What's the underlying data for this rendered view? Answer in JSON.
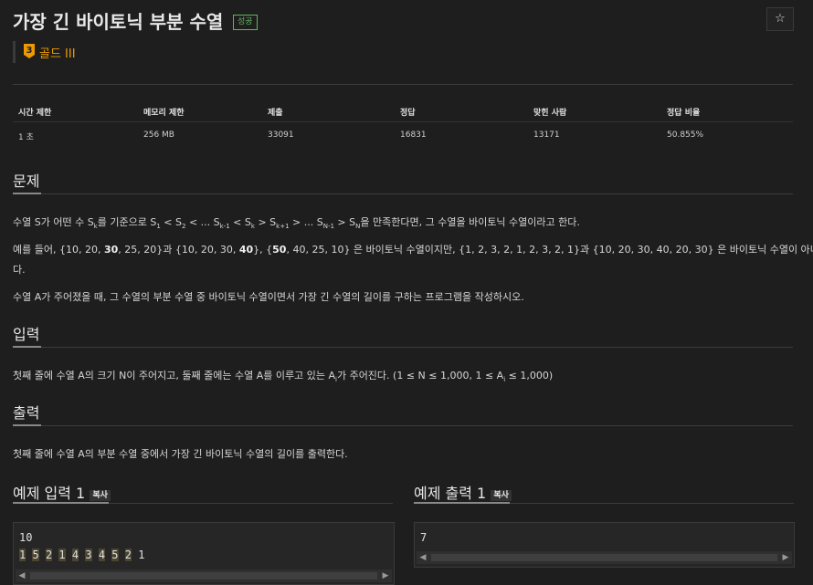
{
  "header": {
    "title": "가장 긴 바이토닉 부분 수열",
    "status_badge": "성공",
    "star_icon": "☆",
    "tier_number": "3",
    "tier_label": "골드 III"
  },
  "stats": {
    "headers": [
      "시간 제한",
      "메모리 제한",
      "제출",
      "정답",
      "맞힌 사람",
      "정답 비율"
    ],
    "values": [
      "1 초",
      "256 MB",
      "33091",
      "16831",
      "13171",
      "50.855%"
    ]
  },
  "problem": {
    "heading": "문제",
    "line1_pre": "수열 S가 어떤 수 S",
    "line1_k": "k",
    "line1_mid": "를 기준으로 S",
    "line1_1": "1",
    "line1_lt1": " < S",
    "line1_2": "2",
    "line1_lt2": " < ... S",
    "line1_km1": "k-1",
    "line1_lt3": " < S",
    "line1_k2": "k",
    "line1_gt1": " > S",
    "line1_kp1": "k+1",
    "line1_gt2": " > ... S",
    "line1_nm1": "N-1",
    "line1_gt3": " > S",
    "line1_n": "N",
    "line1_post": "을 만족한다면, 그 수열을 바이토닉 수열이라고 한다.",
    "line2_a": "예를 들어, {10, 20, ",
    "line2_b": "30",
    "line2_c": ", 25, 20}과 {10, 20, 30, ",
    "line2_d": "40",
    "line2_e": "}, {",
    "line2_f": "50",
    "line2_g": ", 40, 25, 10} 은 바이토닉 수열이지만,  {1, 2, 3, 2, 1, 2, 3, 2, 1}과 {10, 20, 30, 40, 20, 30} 은 바이토닉 수열이 아니",
    "line2_h": "다.",
    "line3": "수열 A가 주어졌을 때, 그 수열의 부분 수열 중 바이토닉 수열이면서 가장 긴 수열의 길이를 구하는 프로그램을 작성하시오."
  },
  "input": {
    "heading": "입력",
    "text_pre": "첫째 줄에 수열 A의 크기 N이 주어지고, 둘째 줄에는 수열 A를 이루고 있는 A",
    "sub_i1": "i",
    "text_mid": "가 주어진다. (1 ≤ N ≤ 1,000, 1 ≤ A",
    "sub_i2": "i",
    "text_post": " ≤ 1,000)"
  },
  "output": {
    "heading": "출력",
    "text": "첫째 줄에 수열 A의 부분 수열 중에서 가장 긴 바이토닉 수열의 길이를 출력한다."
  },
  "example_input": {
    "heading": "예제 입력 1",
    "copy_label": "복사",
    "line1": "10",
    "line2_tokens": [
      "1",
      "5",
      "2",
      "1",
      "4",
      "3",
      "4",
      "5",
      "2",
      "1"
    ]
  },
  "example_output": {
    "heading": "예제 출력 1",
    "copy_label": "복사",
    "line1": "7"
  }
}
